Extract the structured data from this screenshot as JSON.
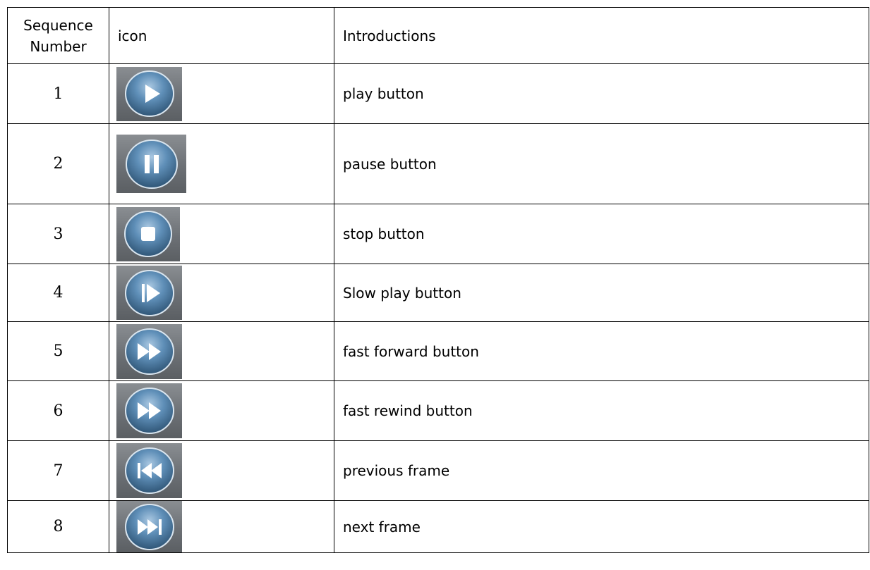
{
  "table": {
    "headers": {
      "sequence": "Sequence Number",
      "icon": "icon",
      "introductions": "Introductions"
    },
    "rows": [
      {
        "number": "1",
        "icon": "play-icon",
        "text": "play button"
      },
      {
        "number": "2",
        "icon": "pause-icon",
        "text": "pause button"
      },
      {
        "number": "3",
        "icon": "stop-icon",
        "text": "stop button"
      },
      {
        "number": "4",
        "icon": "slow-play-icon",
        "text": "Slow play button"
      },
      {
        "number": "5",
        "icon": "fast-forward-icon",
        "text": "fast forward button"
      },
      {
        "number": "6",
        "icon": "fast-rewind-icon",
        "text": "fast rewind button"
      },
      {
        "number": "7",
        "icon": "previous-frame-icon",
        "text": "previous frame"
      },
      {
        "number": "8",
        "icon": "next-frame-icon",
        "text": "next frame"
      }
    ]
  },
  "colors": {
    "tile_background": "#6c7075",
    "button_blue": "#4d7ea8",
    "border": "#000000"
  }
}
